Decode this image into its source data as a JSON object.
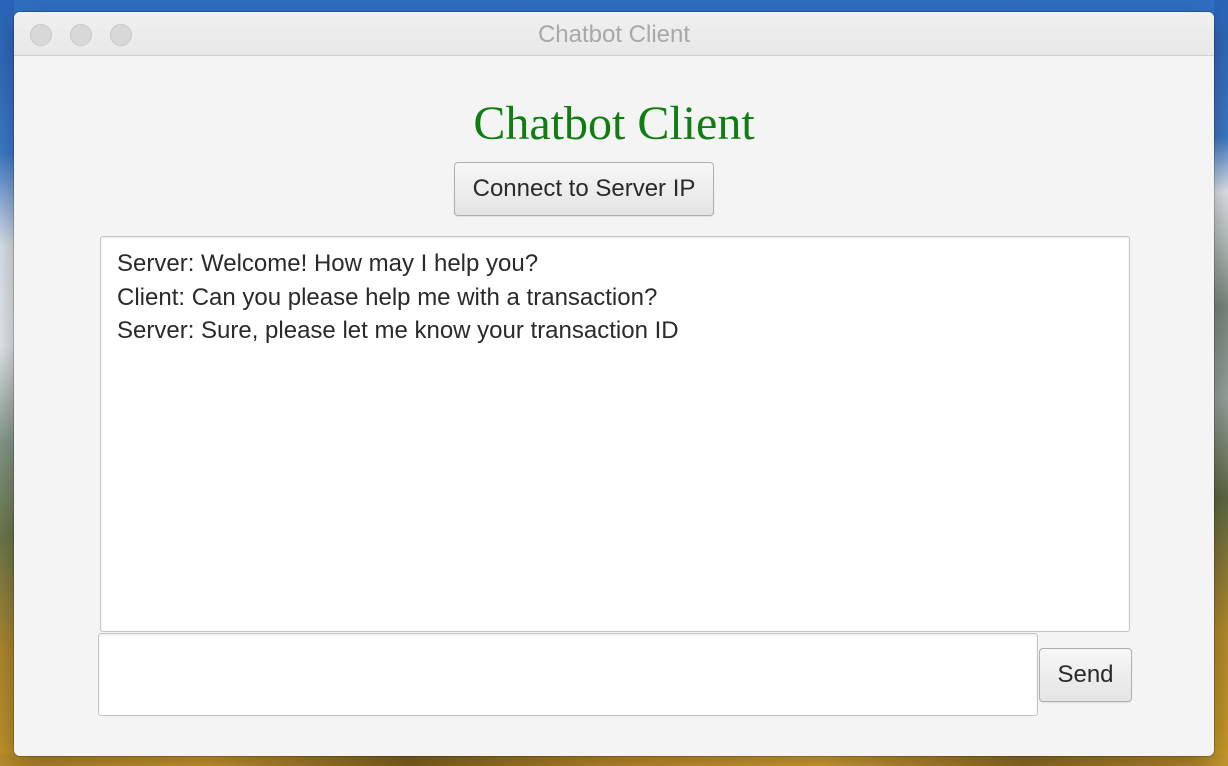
{
  "window": {
    "title": "Chatbot Client"
  },
  "app": {
    "heading": "Chatbot Client",
    "heading_color": "#0f7d12"
  },
  "toolbar": {
    "connect_label": "Connect to Server IP"
  },
  "chat": {
    "messages": [
      "Server: Welcome! How may I help you?",
      "Client: Can you please help me with a transaction?",
      "Server: Sure, please let me know your transaction ID"
    ]
  },
  "composer": {
    "input_value": "",
    "send_label": "Send"
  }
}
